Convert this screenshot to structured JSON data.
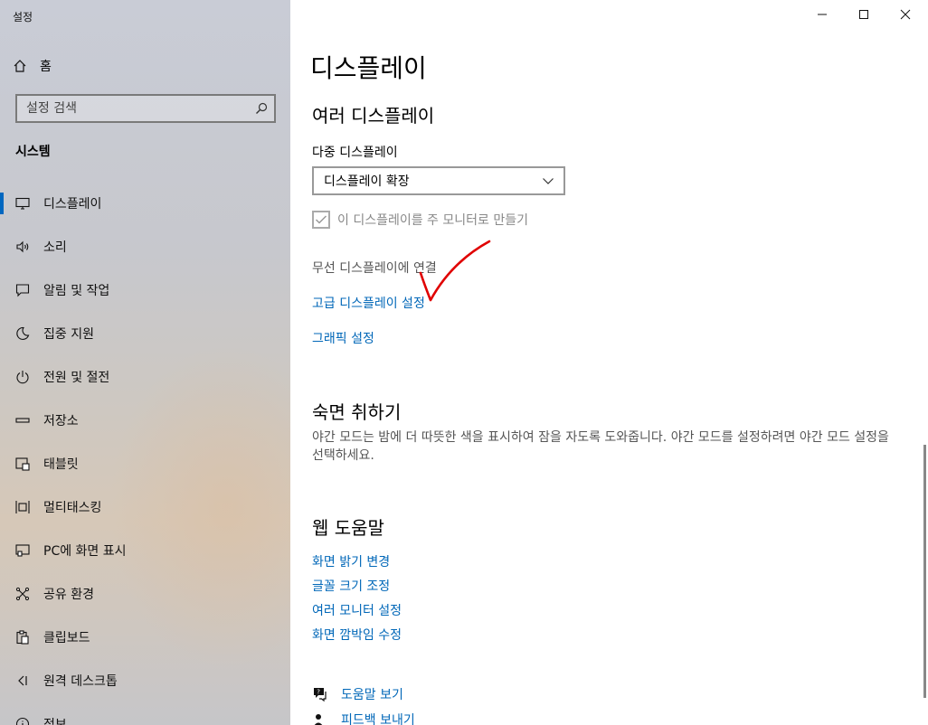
{
  "window": {
    "title": "설정"
  },
  "sidebar": {
    "home_label": "홈",
    "search_placeholder": "설정 검색",
    "section_title": "시스템",
    "items": [
      {
        "label": "디스플레이",
        "icon": "monitor-icon",
        "active": true
      },
      {
        "label": "소리",
        "icon": "speaker-icon"
      },
      {
        "label": "알림 및 작업",
        "icon": "notification-icon"
      },
      {
        "label": "집중 지원",
        "icon": "moon-icon"
      },
      {
        "label": "전원 및 절전",
        "icon": "power-icon"
      },
      {
        "label": "저장소",
        "icon": "storage-icon"
      },
      {
        "label": "태블릿",
        "icon": "tablet-icon"
      },
      {
        "label": "멀티태스킹",
        "icon": "multitasking-icon"
      },
      {
        "label": "PC에 화면 표시",
        "icon": "project-icon"
      },
      {
        "label": "공유 환경",
        "icon": "shared-experiences-icon"
      },
      {
        "label": "클립보드",
        "icon": "clipboard-icon"
      },
      {
        "label": "원격 데스크톱",
        "icon": "remote-desktop-icon"
      },
      {
        "label": "정보",
        "icon": "info-icon"
      }
    ]
  },
  "main": {
    "page_title": "디스플레이",
    "multi_display": {
      "heading": "여러 디스플레이",
      "label": "다중 디스플레이",
      "dropdown_value": "디스플레이 확장",
      "checkbox_label": "이 디스플레이를 주 모니터로 만들기",
      "checkbox_checked": true,
      "wireless_text": "무선 디스플레이에 연결",
      "advanced_link": "고급 디스플레이 설정",
      "graphics_link": "그래픽 설정"
    },
    "sleep": {
      "heading": "숙면 취하기",
      "description": "야간 모드는 밤에 더 따뜻한 색을 표시하여 잠을 자도록 도와줍니다. 야간 모드를 설정하려면 야간 모드 설정을 선택하세요."
    },
    "web_help": {
      "heading": "웹 도움말",
      "links": [
        "화면 밝기 변경",
        "글꼴 크기 조정",
        "여러 모니터 설정",
        "화면 깜박임 수정"
      ]
    },
    "help": {
      "get_help": "도움말 보기",
      "feedback": "피드백 보내기"
    }
  },
  "colors": {
    "accent": "#0067b8",
    "annotation": "#e00000"
  }
}
